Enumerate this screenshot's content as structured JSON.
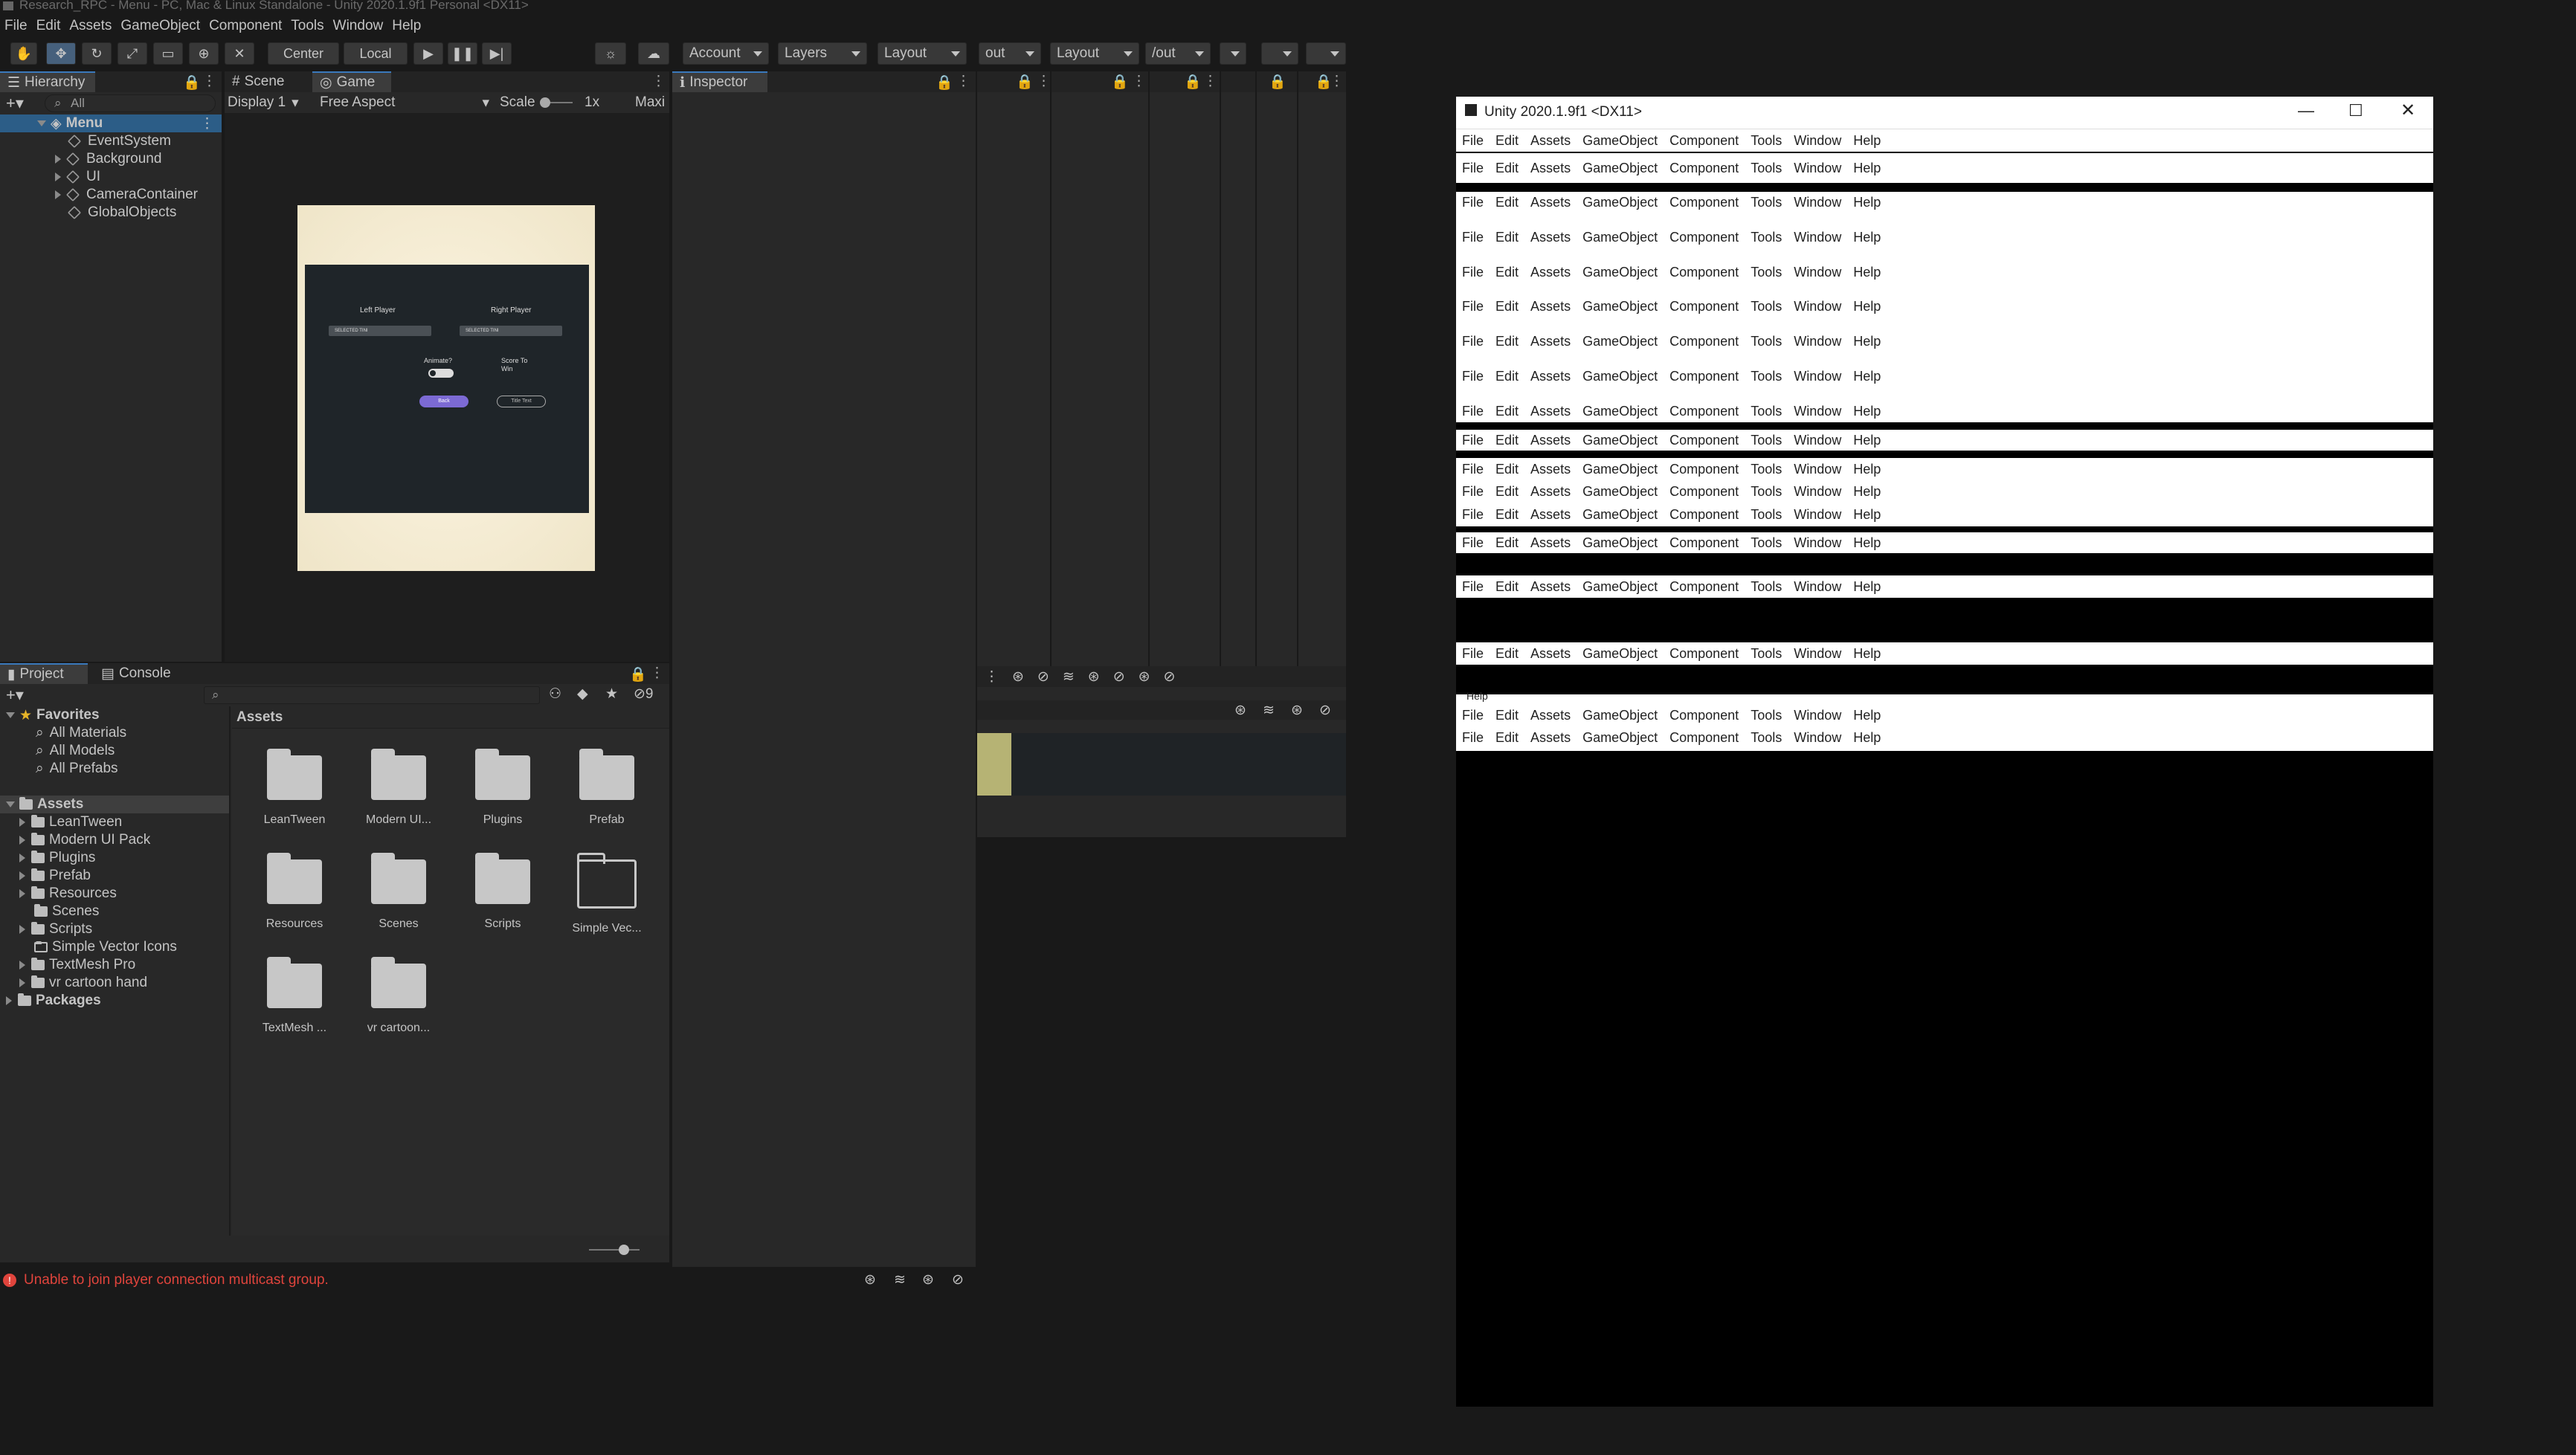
{
  "window_title": "Research_RPC - Menu - PC, Mac & Linux Standalone - Unity 2020.1.9f1 Personal <DX11>",
  "menu": [
    "File",
    "Edit",
    "Assets",
    "GameObject",
    "Component",
    "Tools",
    "Window",
    "Help"
  ],
  "toolbar": {
    "center_label": "Center",
    "local_label": "Local",
    "account_label": "Account",
    "layers_label": "Layers",
    "layout_label": "Layout",
    "out_label": "out",
    "layout2_label": "Layout",
    "yout_label": "/out"
  },
  "hierarchy": {
    "tab": "Hierarchy",
    "search_placeholder": "All",
    "scene": "Menu",
    "items": [
      "EventSystem",
      "Background",
      "UI",
      "CameraContainer",
      "GlobalObjects"
    ]
  },
  "scene_tabs": {
    "scene": "Scene",
    "game": "Game"
  },
  "game_bar": {
    "display": "Display 1",
    "aspect": "Free Aspect",
    "scale_label": "Scale",
    "scale_value": "1x",
    "maximize": "Maxi"
  },
  "game_view": {
    "left_player": "Left Player",
    "right_player": "Right Player",
    "left_dropdown": "SELECTED TINI",
    "right_dropdown": "SELECTED TINI",
    "animate": "Animate?",
    "score_to_win": "Score To Win",
    "back_button": "Back",
    "title_text": "Title Text"
  },
  "inspector": {
    "tab": "Inspector"
  },
  "project": {
    "tab_project": "Project",
    "tab_console": "Console",
    "hidden_count": "9",
    "favorites": "Favorites",
    "favorites_items": [
      "All Materials",
      "All Models",
      "All Prefabs"
    ],
    "assets": "Assets",
    "assets_children": [
      "LeanTween",
      "Modern UI Pack",
      "Plugins",
      "Prefab",
      "Resources",
      "Scenes",
      "Scripts",
      "Simple Vector Icons",
      "TextMesh Pro",
      "vr cartoon hand"
    ],
    "packages": "Packages",
    "breadcrumb": "Assets",
    "grid": [
      "LeanTween",
      "Modern UI...",
      "Plugins",
      "Prefab",
      "Resources",
      "Scenes",
      "Scripts",
      "Simple Vec...",
      "TextMesh ...",
      "vr cartoon..."
    ]
  },
  "status": {
    "error": "Unable to join player connection multicast group."
  },
  "ghost_window": {
    "title": "Unity 2020.1.9f1 <DX11>",
    "help_fragment": "Help"
  }
}
